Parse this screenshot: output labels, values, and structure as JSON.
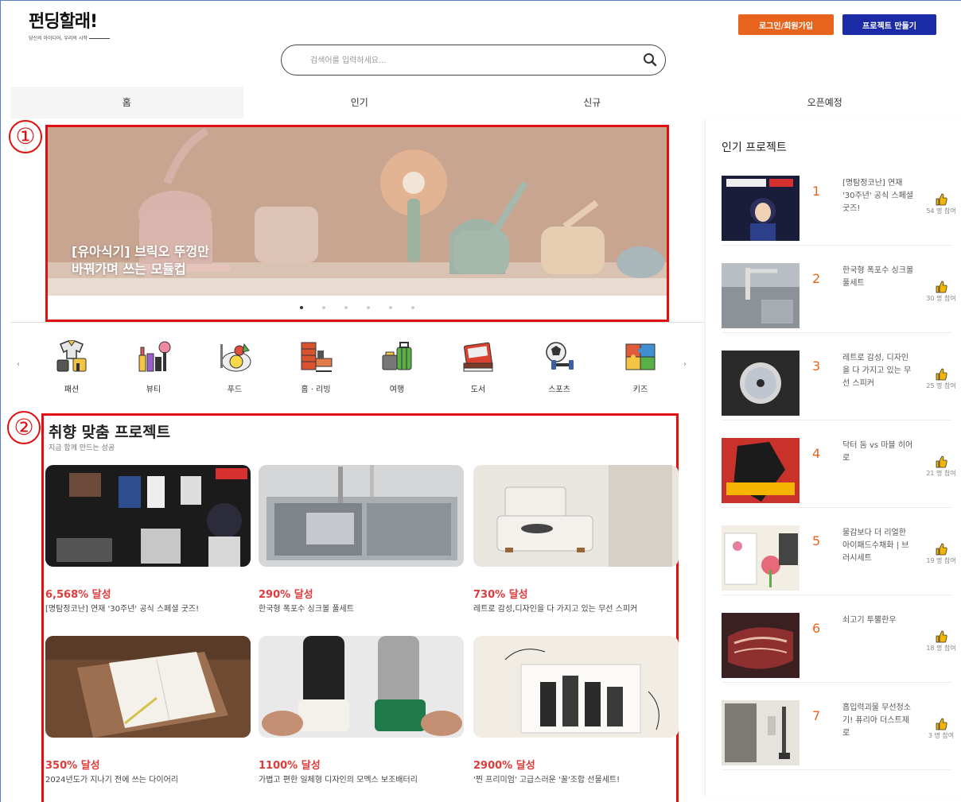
{
  "header": {
    "logo_text": "펀딩할래!",
    "logo_tagline": "당신의 아이디어, 우리의 시작",
    "login_label": "로그인/회원가입",
    "create_label": "프로젝트 만들기"
  },
  "search": {
    "placeholder": "검색어를 입력하세요..."
  },
  "nav": {
    "tabs": [
      "홈",
      "인기",
      "신규",
      "오픈예정"
    ]
  },
  "banner": {
    "title_line1": "[유아식기] 브릭오 뚜껑만",
    "title_line2": "바꿔가며 쓰는 모듈컵",
    "slide_count": 6,
    "active_slide": 1
  },
  "markers": [
    "①",
    "②"
  ],
  "categories": [
    {
      "label": "패션",
      "icon": "fashion-icon"
    },
    {
      "label": "뷰티",
      "icon": "beauty-icon"
    },
    {
      "label": "푸드",
      "icon": "food-icon"
    },
    {
      "label": "홈 · 리빙",
      "icon": "home-living-icon"
    },
    {
      "label": "여행",
      "icon": "travel-icon"
    },
    {
      "label": "도서",
      "icon": "book-icon"
    },
    {
      "label": "스포츠",
      "icon": "sports-icon"
    },
    {
      "label": "키즈",
      "icon": "kids-icon"
    }
  ],
  "category_arrows": {
    "prev": "‹",
    "next": "›"
  },
  "recommended": {
    "title": "취향 맞춤 프로젝트",
    "subtitle": "지금 함께 만드는 성공",
    "cards": [
      {
        "rate": "6,568% 달성",
        "name": "[명탐정코난] 연재 '30주년' 공식 스페셜 굿즈!"
      },
      {
        "rate": "290% 달성",
        "name": "한국형 폭포수 싱크볼 풀세트"
      },
      {
        "rate": "730% 달성",
        "name": "레트로 감성,디자인을 다 가지고 있는 무선 스피커"
      },
      {
        "rate": "350% 달성",
        "name": "2024년도가 지나기 전에 쓰는 다이어리"
      },
      {
        "rate": "1100% 달성",
        "name": "가볍고 편한 일체형 디자인의 모멕스 보조배터리"
      },
      {
        "rate": "2900% 달성",
        "name": "'찐 프리미엄' 고급스러운 '꿀'조합 선물세트!"
      }
    ]
  },
  "popular": {
    "title": "인기 프로젝트",
    "items": [
      {
        "rank": "1",
        "name": "[명탐정코난] 연재 '30주년' 공식 스페셜 굿즈!",
        "count": "54 명 참여"
      },
      {
        "rank": "2",
        "name": "한국형 폭포수 싱크볼 풀세트",
        "count": "30 명 참여"
      },
      {
        "rank": "3",
        "name": "레트로 감성, 디자인을 다 가지고 있는 무선 스피커",
        "count": "25 명 참여"
      },
      {
        "rank": "4",
        "name": "닥터 둠 vs 마블 히어로",
        "count": "21 명 참여"
      },
      {
        "rank": "5",
        "name": "물감보다 더 리얼한 아이패드수채화 | 브러시세트",
        "count": "19 명 참여"
      },
      {
        "rank": "6",
        "name": "쇠고기 투뿔한우",
        "count": "18 명 참여"
      },
      {
        "rank": "7",
        "name": "흡입력괴물 무선청소기! 퓨리아 더스트제로",
        "count": "3 명 참여"
      }
    ]
  },
  "colors": {
    "accent_orange": "#e8631c",
    "accent_navy": "#1b2aa5",
    "highlight_red": "#e01010",
    "rate_red": "#e03a3a"
  }
}
